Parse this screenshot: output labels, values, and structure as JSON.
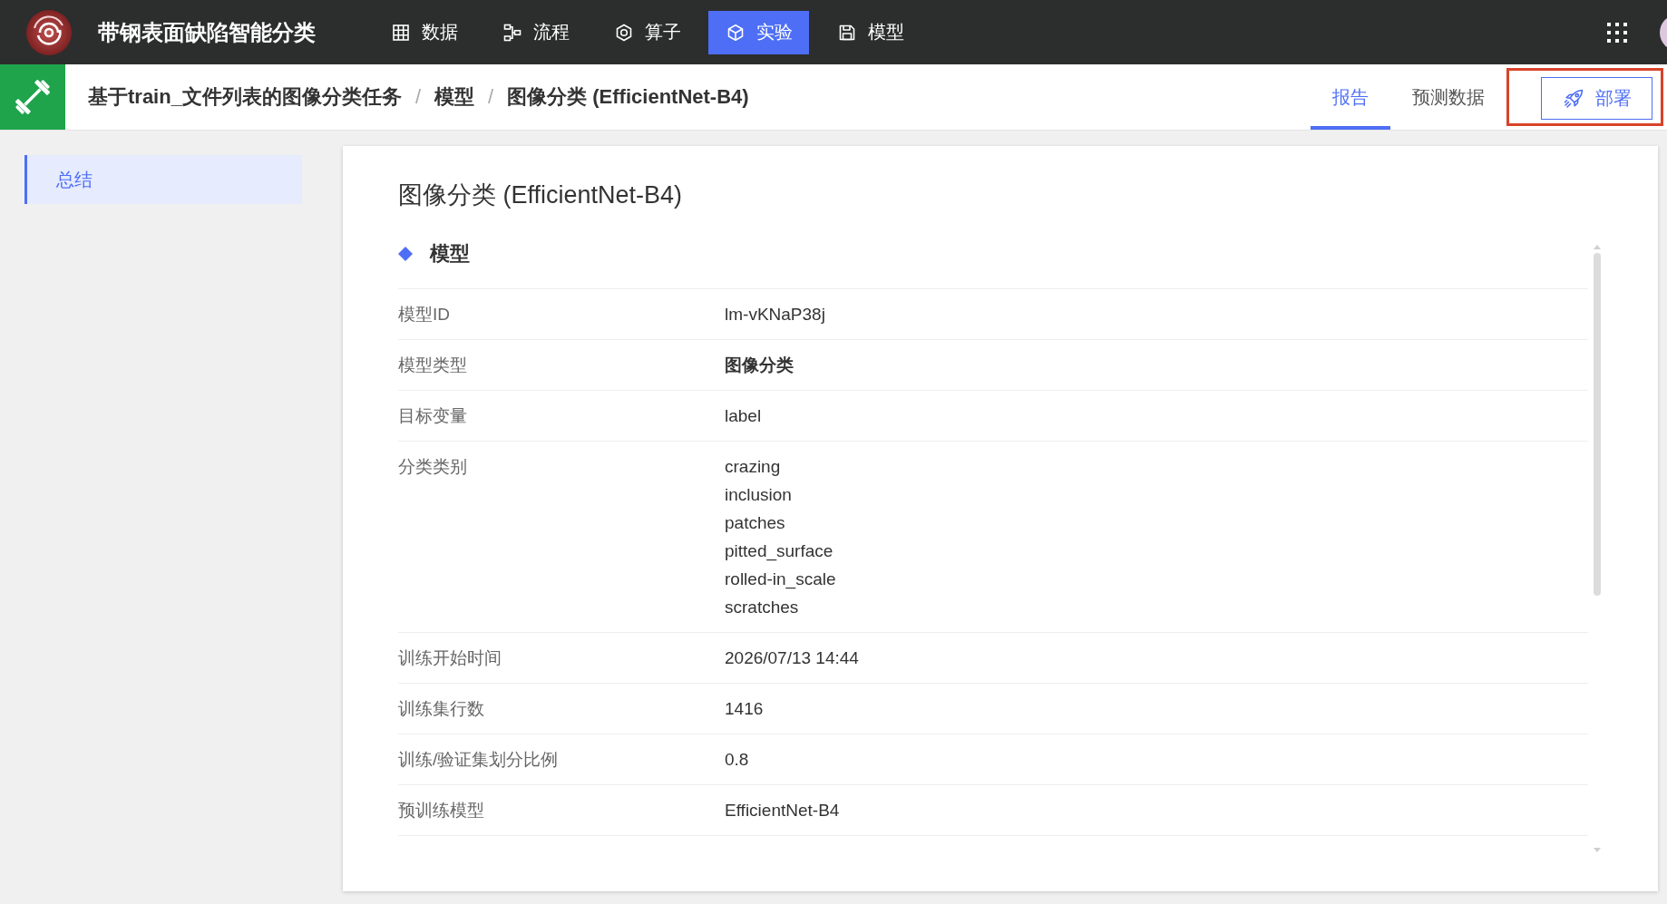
{
  "app": {
    "title": "带钢表面缺陷智能分类"
  },
  "nav": [
    {
      "label": "数据",
      "selected": false
    },
    {
      "label": "流程",
      "selected": false
    },
    {
      "label": "算子",
      "selected": false
    },
    {
      "label": "实验",
      "selected": true
    },
    {
      "label": "模型",
      "selected": false
    }
  ],
  "breadcrumb": [
    {
      "kind": "crumb",
      "label": "基于train_文件列表的图像分类任务"
    },
    {
      "kind": "separator",
      "label": "/"
    },
    {
      "kind": "crumb",
      "label": "模型"
    },
    {
      "kind": "separator",
      "label": "/"
    },
    {
      "kind": "crumb",
      "label": "图像分类 (EfficientNet-B4)"
    }
  ],
  "tabs": [
    {
      "label": "报告",
      "selected": true
    },
    {
      "label": "预测数据",
      "selected": false
    }
  ],
  "deploy_button": {
    "label": "部署",
    "highlighted": true
  },
  "sidebar": {
    "items": [
      {
        "label": "总结",
        "selected": true
      }
    ]
  },
  "report": {
    "title": "图像分类 (EfficientNet-B4)",
    "section": "模型",
    "rows": [
      {
        "label": "模型ID",
        "values": [
          "lm-vKNaP38j"
        ],
        "bold": false
      },
      {
        "label": "模型类型",
        "values": [
          "图像分类"
        ],
        "bold": true
      },
      {
        "label": "目标变量",
        "values": [
          "label"
        ],
        "bold": false
      },
      {
        "label": "分类类别",
        "values": [
          "crazing",
          "inclusion",
          "patches",
          "pitted_surface",
          "rolled-in_scale",
          "scratches"
        ],
        "bold": false
      },
      {
        "label": "训练开始时间",
        "values": [
          "2026/07/13 14:44"
        ],
        "bold": false
      },
      {
        "label": "训练集行数",
        "values": [
          "1416"
        ],
        "bold": false
      },
      {
        "label": "训练/验证集划分比例",
        "values": [
          "0.8"
        ],
        "bold": false
      },
      {
        "label": "预训练模型",
        "values": [
          "EfficientNet-B4"
        ],
        "bold": false
      }
    ]
  }
}
